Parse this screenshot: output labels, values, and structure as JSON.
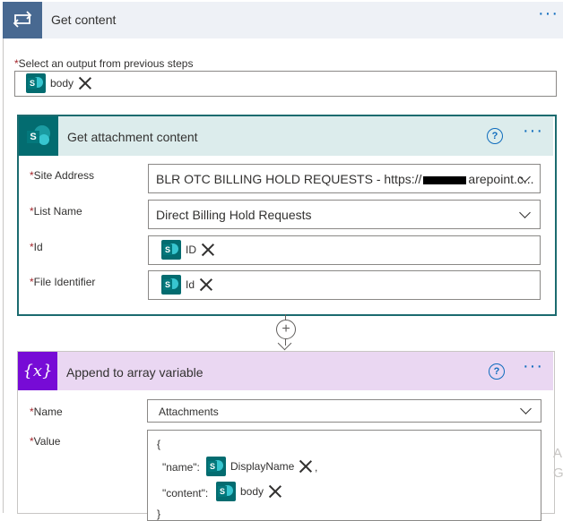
{
  "loop": {
    "title": "Get content",
    "select_output_label": "Select an output from previous steps",
    "required_mark": "*",
    "output_token": "body"
  },
  "sharepoint_action": {
    "title": "Get attachment content",
    "help": "?",
    "fields": {
      "site_address_label": "Site Address",
      "site_address_prefix": "BLR OTC BILLING HOLD REQUESTS - https://",
      "site_address_suffix": "arepoint.c...",
      "list_name_label": "List Name",
      "list_name_value": "Direct Billing Hold Requests",
      "id_label": "Id",
      "id_token": "ID",
      "file_identifier_label": "File Identifier",
      "file_identifier_token": "Id"
    }
  },
  "connector": {
    "add_symbol": "+"
  },
  "append_action": {
    "title": "Append to array variable",
    "icon_text": "{x}",
    "help": "?",
    "name_label": "Name",
    "name_value": "Attachments",
    "value_label": "Value",
    "value_open_brace": "{",
    "value_name_key": "\"name\":",
    "value_name_token": "DisplayName",
    "value_comma": ",",
    "value_content_key": "\"content\":",
    "value_content_token": "body",
    "value_close_brace": "}"
  },
  "side_letters": [
    "A",
    "G"
  ],
  "more_icon": "···",
  "colors": {
    "loop_accent": "#486991",
    "sharepoint_accent": "#036c70",
    "variable_accent": "#770bd6",
    "link_blue": "#0f6cbd",
    "required_red": "#a4262c"
  }
}
